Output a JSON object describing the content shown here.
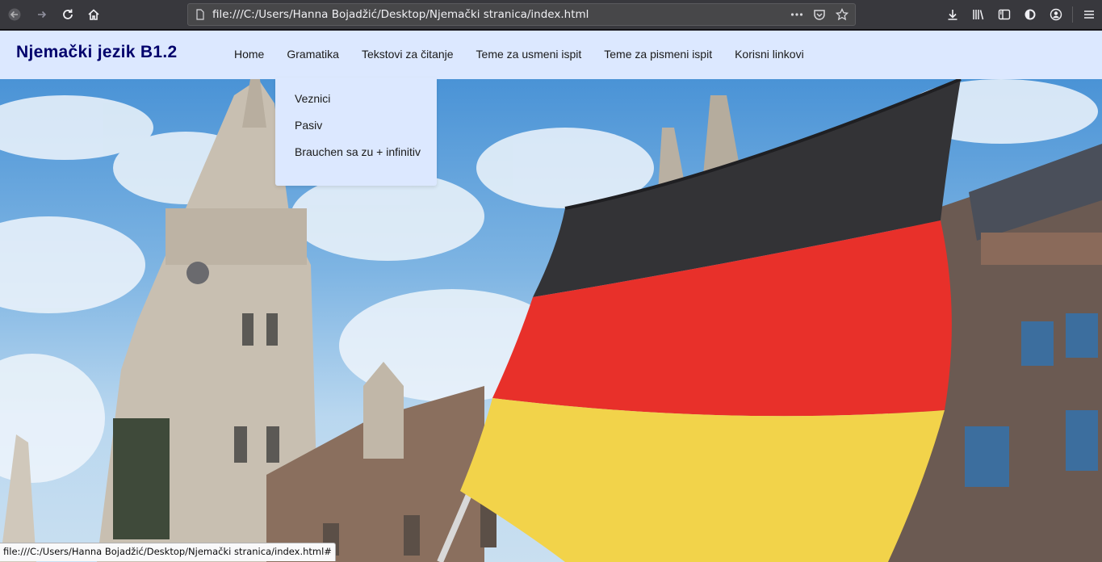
{
  "browser": {
    "url": "file:///C:/Users/Hanna Bojadžić/Desktop/Njemački stranica/index.html",
    "status_url": "file:///C:/Users/Hanna Bojadžić/Desktop/Njemački stranica/index.html#",
    "toolbar_icons": [
      "back-icon",
      "forward-icon",
      "reload-icon",
      "home-icon",
      "page-icon",
      "more-icon",
      "pocket-icon",
      "bookmark-star-icon",
      "download-icon",
      "library-icon",
      "sidebar-icon",
      "shield-icon",
      "account-icon",
      "menu-icon"
    ]
  },
  "site": {
    "brand": "Njemački jezik B1.2",
    "nav": [
      "Home",
      "Gramatika",
      "Tekstovi za čitanje",
      "Teme za usmeni ispit",
      "Teme za pismeni ispit",
      "Korisni linkovi"
    ],
    "dropdown": [
      "Veznici",
      "Pasiv",
      "Brauchen sa zu + infinitiv"
    ],
    "hero_image": "German flag in front of Munich town hall"
  },
  "colors": {
    "nav_bg": "#dce8ff",
    "brand": "#00006b",
    "chrome": "#38383d",
    "flag_black": "#2a2a2a",
    "flag_red": "#e8302a",
    "flag_gold": "#f2d34a"
  }
}
